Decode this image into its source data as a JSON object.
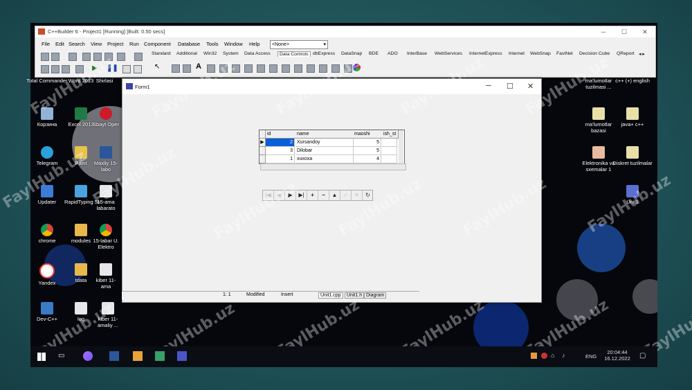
{
  "ide": {
    "title": "C++Builder 6 - Project1 [Running] [Built: 0.50 secs]",
    "menus": [
      "File",
      "Edit",
      "Search",
      "View",
      "Project",
      "Run",
      "Component",
      "Database",
      "Tools",
      "Window",
      "Help"
    ],
    "combo": "<None>",
    "palette_tabs": [
      "Standard",
      "Additional",
      "Win32",
      "System",
      "Data Access",
      "Data Controls",
      "dbExpress",
      "DataSnap",
      "BDE",
      "ADO",
      "InterBase",
      "WebServices",
      "InternetExpress",
      "Internet",
      "WebSnap",
      "FastNet",
      "Decision Cube",
      "QReport"
    ],
    "active_palette": "Data Controls"
  },
  "form": {
    "title": "Form1",
    "grid": {
      "columns": [
        "id",
        "name",
        "maoshi",
        "ish_st"
      ],
      "rows": [
        {
          "id": "2",
          "name": "Xursandoy",
          "maoshi": "5"
        },
        {
          "id": "3",
          "name": "Dilobar",
          "maoshi": "5"
        },
        {
          "id": "1",
          "name": "xuxoxa",
          "maoshi": "4"
        }
      ]
    },
    "navigator": [
      "|◀",
      "◀",
      "▶",
      "▶|",
      "+",
      "−",
      "▲",
      "✓",
      "✕",
      "↻"
    ]
  },
  "status": {
    "pos": "1:   1",
    "modified": "Modified",
    "insert": "Insert",
    "tabs": [
      "Unit1.cpp",
      "Unit1.h",
      "Diagram"
    ]
  },
  "desktop": {
    "left_icons": [
      "Total Commander",
      "Word 2013",
      "Shirlasi",
      "Корзина",
      "Excel 2013",
      "Sbayt Oper",
      "Telegram",
      "Paint",
      "Maxliy 15-labo",
      "Updater",
      "RapidTyping 5",
      "15-ama labarato",
      "chrome",
      "modules",
      "15-labar U. Elektro",
      "Yandex",
      "tdata",
      "kiber 11-ama",
      "Dev-C++",
      "log",
      "kiber 11-amaliy ..."
    ],
    "right_icons": [
      "ma'lumotlar tuzilmasi ...",
      "c++ (+) english",
      "ma'lumotlar bazasi",
      "java+ c++",
      "Elektronika va sxemalar 1",
      "Diskret tuzilmalar",
      "Unit1"
    ]
  },
  "watermark": "FaylHub.uz",
  "taskbar": {
    "time": "20:04:44",
    "date": "16.12.2022",
    "lang": "ENG"
  }
}
